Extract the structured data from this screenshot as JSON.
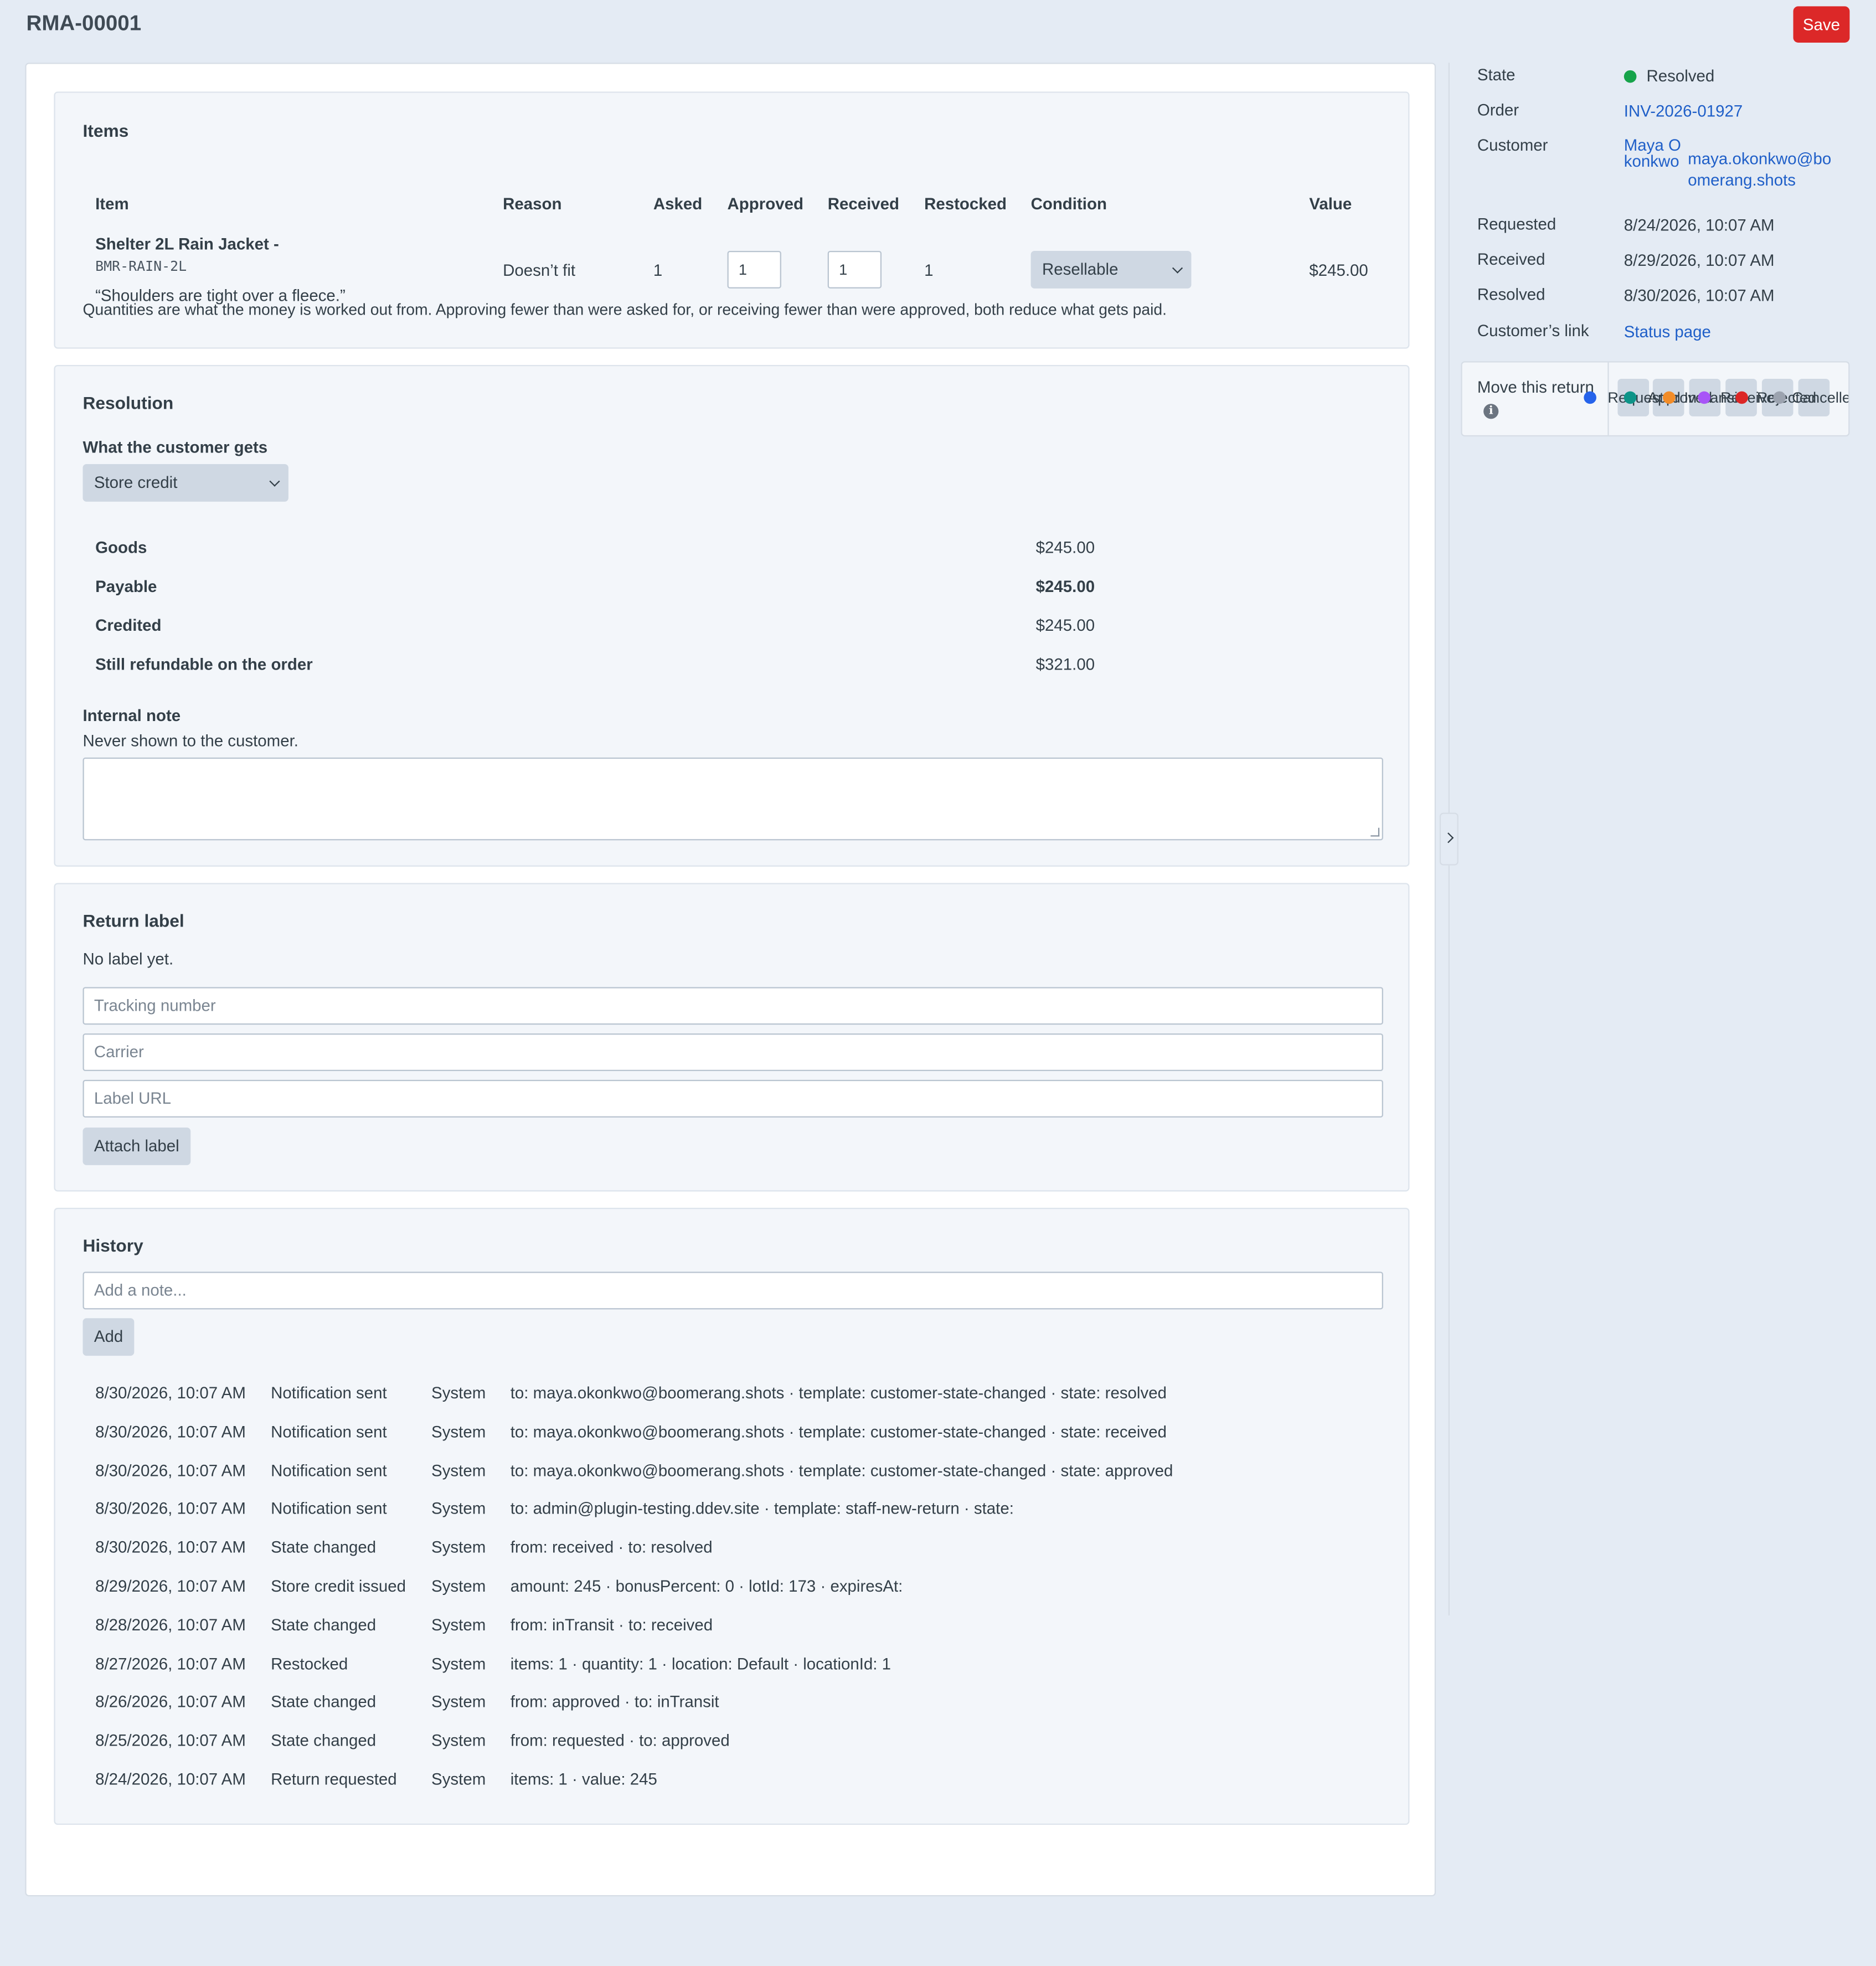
{
  "header": {
    "title": "RMA-00001",
    "save_label": "Save"
  },
  "items": {
    "title": "Items",
    "columns": [
      "Item",
      "Reason",
      "Asked",
      "Approved",
      "Received",
      "Restocked",
      "Condition",
      "Value"
    ],
    "row": {
      "name": "Shelter 2L Rain Jacket -",
      "sku": "BMR-RAIN-2L",
      "comment": "“Shoulders are tight over a fleece.”",
      "reason": "Doesn’t fit",
      "asked": "1",
      "approved": "1",
      "received": "1",
      "restocked": "1",
      "condition": "Resellable",
      "value": "$245.00"
    },
    "footnote": "Quantities are what the money is worked out from. Approving fewer than were asked for, or receiving fewer than were approved, both reduce what gets paid."
  },
  "resolution": {
    "title": "Resolution",
    "customer_gets_label": "What the customer gets",
    "customer_gets_value": "Store credit",
    "summary": [
      {
        "label": "Goods",
        "value": "$245.00"
      },
      {
        "label": "Payable",
        "value": "$245.00"
      },
      {
        "label": "Credited",
        "value": "$245.00"
      },
      {
        "label": "Still refundable on the order",
        "value": "$321.00"
      }
    ],
    "internal_note_label": "Internal note",
    "internal_note_help": "Never shown to the customer.",
    "internal_note_value": ""
  },
  "return_label": {
    "title": "Return label",
    "status": "No label yet.",
    "tracking_placeholder": "Tracking number",
    "carrier_placeholder": "Carrier",
    "url_placeholder": "Label URL",
    "attach_label": "Attach label"
  },
  "history": {
    "title": "History",
    "note_placeholder": "Add a note...",
    "add_label": "Add",
    "entries": [
      {
        "time": "8/30/2026, 10:07 AM",
        "event": "Notification sent",
        "actor": "System",
        "detail": "to: maya.okonkwo@boomerang.shots · template: customer-state-changed · state: resolved"
      },
      {
        "time": "8/30/2026, 10:07 AM",
        "event": "Notification sent",
        "actor": "System",
        "detail": "to: maya.okonkwo@boomerang.shots · template: customer-state-changed · state: received"
      },
      {
        "time": "8/30/2026, 10:07 AM",
        "event": "Notification sent",
        "actor": "System",
        "detail": "to: maya.okonkwo@boomerang.shots · template: customer-state-changed · state: approved"
      },
      {
        "time": "8/30/2026, 10:07 AM",
        "event": "Notification sent",
        "actor": "System",
        "detail": "to: admin@plugin-testing.ddev.site · template: staff-new-return · state:"
      },
      {
        "time": "8/30/2026, 10:07 AM",
        "event": "State changed",
        "actor": "System",
        "detail": "from: received · to: resolved"
      },
      {
        "time": "8/29/2026, 10:07 AM",
        "event": "Store credit issued",
        "actor": "System",
        "detail": "amount: 245 · bonusPercent: 0 · lotId: 173 · expiresAt:"
      },
      {
        "time": "8/28/2026, 10:07 AM",
        "event": "State changed",
        "actor": "System",
        "detail": "from: inTransit · to: received"
      },
      {
        "time": "8/27/2026, 10:07 AM",
        "event": "Restocked",
        "actor": "System",
        "detail": "items: 1 · quantity: 1 · location: Default · locationId: 1"
      },
      {
        "time": "8/26/2026, 10:07 AM",
        "event": "State changed",
        "actor": "System",
        "detail": "from: approved · to: inTransit"
      },
      {
        "time": "8/25/2026, 10:07 AM",
        "event": "State changed",
        "actor": "System",
        "detail": "from: requested · to: approved"
      },
      {
        "time": "8/24/2026, 10:07 AM",
        "event": "Return requested",
        "actor": "System",
        "detail": "items: 1 · value: 245"
      }
    ]
  },
  "sidebar": {
    "state_label": "State",
    "state_value": "Resolved",
    "state_color": "#16a34a",
    "order_label": "Order",
    "order_value": "INV-2026-01927",
    "customer_label": "Customer",
    "customer_name": "Maya Okonkwo",
    "customer_email": "maya.okonkwo@boomerang.shots",
    "requested_label": "Requested",
    "requested_value": "8/24/2026, 10:07 AM",
    "received_label": "Received",
    "received_value": "8/29/2026, 10:07 AM",
    "resolved_label": "Resolved",
    "resolved_value": "8/30/2026, 10:07 AM",
    "link_label": "Customer’s link",
    "link_value": "Status page",
    "move_label": "Move this return",
    "move_options": [
      {
        "label": "Requested",
        "color": "#2563eb"
      },
      {
        "label": "Approved",
        "color": "#0d9488"
      },
      {
        "label": "In transit",
        "color": "#f28c28"
      },
      {
        "label": "Received",
        "color": "#a855f7"
      },
      {
        "label": "Rejected",
        "color": "#dc2626"
      },
      {
        "label": "Cancelled",
        "color": "#9ca3af"
      }
    ]
  }
}
